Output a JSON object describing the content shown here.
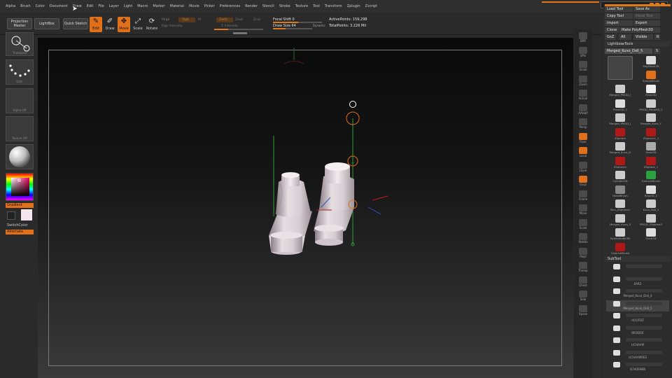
{
  "menu": [
    "Alpha",
    "Brush",
    "Color",
    "Document",
    "Draw",
    "Edit",
    "File",
    "Layer",
    "Light",
    "Macro",
    "Marker",
    "Material",
    "Movie",
    "Picker",
    "Preferences",
    "Render",
    "Stencil",
    "Stroke",
    "Texture",
    "Tool",
    "Transform",
    "Zplugin",
    "Zscript"
  ],
  "shelf": {
    "projection_master": "Projection Master",
    "lightbox": "LightBox",
    "quick_sketch": "Quick Sketch",
    "edit": "Edit",
    "draw": "Draw",
    "move": "Move",
    "scale": "Scale",
    "rotate": "Rotate",
    "mrgb": "Mrgb",
    "rgb": "Rgb",
    "m": "M",
    "zadd": "Zadd",
    "zsub": "Zsub",
    "zcut": "Zcut",
    "rgb_intensity": "Rgb Intensity",
    "z_intensity": "Z Intensity",
    "focal_shift": "Focal Shift 0",
    "draw_size": "Draw Size 64",
    "dynamic": "Dynamic",
    "active_points": "ActivePoints: 159,298",
    "total_points": "TotalPoints: 3.226 Mil"
  },
  "left": {
    "transpose": "Transpose",
    "dots": "Dots",
    "alpha": "Alpha Off",
    "texture": "Texture Off",
    "gradient": "Gradient",
    "switch_color": "SwitchColor",
    "alternate": "Alternate"
  },
  "nav": [
    "BPR",
    "SPix",
    "Scroll",
    "Zoom",
    "Actual",
    "AAHalf",
    "Persp",
    "Floor",
    "Local",
    "LSym",
    "Gxyz",
    "Frame",
    "Move",
    "Scale",
    "Rotate",
    "Polyf",
    "Transp",
    "Ghost",
    "Solo",
    "Xpose"
  ],
  "palette": {
    "load_tool": "Load Tool",
    "save_as": "Save As",
    "copy_tool": "Copy Tool",
    "paste_tool": "Paste Tool",
    "import": "Import",
    "export": "Export",
    "clone": "Clone",
    "make_polymesh": "Make PolyMesh3D",
    "goz": "GoZ",
    "all": "All",
    "visible": "Visible",
    "r": "R",
    "lightbox_tools": "Lightbox▸Tools",
    "current_tool": "Merged_Kuvo_Doll_5",
    "current_tool_value": "5",
    "tools": [
      "PolyMesh3D",
      "SimpleBrush",
      "Merged_PMOD_(",
      "Plane3D",
      "Plane3D_1",
      "PMOD_Plane3D_1",
      "Merged_PMOD_(",
      "Merged_Kuvo_Y",
      "ZSphere",
      "ZSphere1_1",
      "Merged_Kuvo_D",
      "Helix3D",
      "ZSphere1",
      "ZSphere_1",
      "Cylinder3D",
      "ExtrudeBrush",
      "NoiseBrush",
      "Ring3D_2",
      "Skin_ZSphere1",
      "Kuvo_Doll_3",
      "Merged_Kuvo_3",
      "PMOD_ZSphere3",
      "Sphereinder3D",
      "Cone3D",
      "ColorizeBrush"
    ],
    "subtool_title": "SubTool",
    "subtools": [
      "",
      "EARZ",
      "Merged_Kuvo_Doll_4",
      "Merged_Kuvo_Doll_5",
      "HOOFDZ",
      "BRODOE",
      "LICHAAM",
      "LICHAAMRES",
      "SCHOENEN"
    ]
  },
  "colors": {
    "accent": "#e0701a",
    "menu_bg": "#2f2f2f",
    "canvas_top": "#0a0a0a",
    "canvas_bottom": "#3a3a3a"
  }
}
